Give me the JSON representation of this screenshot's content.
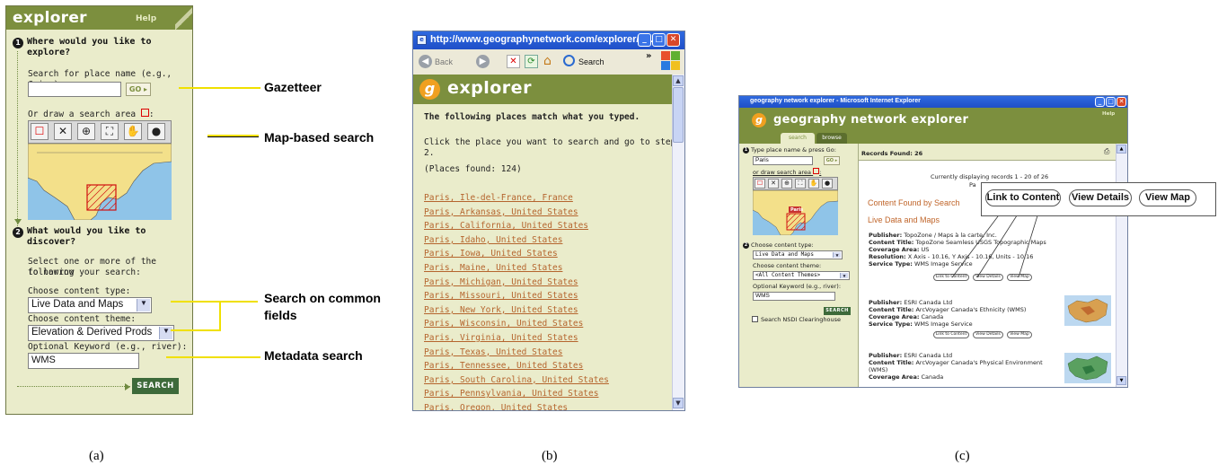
{
  "panel_a": {
    "logo": "explorer",
    "help": "Help",
    "step1_num": "1",
    "step1_title_line1": "Where would you like to",
    "step1_title_line2": "explore?",
    "search_place_label": "Search for place name (e.g., Cairo):",
    "go_label": "GO ▸",
    "draw_area_label": "Or draw a search area",
    "tools": [
      "☐",
      "✕",
      "⊕",
      "⛶",
      "✋",
      "🌐"
    ],
    "step2_num": "2",
    "step2_title_line1": "What would you like to",
    "step2_title_line2": "discover?",
    "select_hint_line1": "Select one or more of the following",
    "select_hint_line2": "to narrow your search:",
    "content_type_label": "Choose content type:",
    "content_type_value": "Live Data and Maps",
    "content_theme_label": "Choose content theme:",
    "content_theme_value": "Elevation & Derived Prods",
    "keyword_label": "Optional Keyword (e.g., river):",
    "keyword_value": "WMS",
    "search_button": "SEARCH"
  },
  "annotations": {
    "gazetteer": "Gazetteer",
    "map_search": "Map-based search",
    "common_fields_line1": "Search on common",
    "common_fields_line2": "fields",
    "metadata": "Metadata search"
  },
  "panel_b": {
    "url": "http://www.geographynetwork.com/explorer/g...",
    "back": "Back",
    "search": "Search",
    "logo": "explorer",
    "heading": "The following places match what you typed.",
    "instruction": "Click the place you want to search and go to step 2.",
    "found": "(Places found: 124)",
    "places": [
      "Paris, Ile-del-France, France",
      "Paris, Arkansas, United States",
      "Paris, California, United States",
      "Paris, Idaho, United States",
      "Paris, Iowa, United States",
      "Paris, Maine, United States",
      "Paris, Michigan, United States",
      "Paris, Missouri, United States",
      "Paris, New York, United States",
      "Paris, Wisconsin, United States",
      "Paris, Virginia, United States",
      "Paris, Texas, United States",
      "Paris, Tennessee, United States",
      "Paris, South Carolina, United States",
      "Paris, Pennsylvania, United States",
      "Paris, Oregon, United States"
    ]
  },
  "panel_c": {
    "window_title": "geography network explorer - Microsoft Internet Explorer",
    "logo": "geography network explorer",
    "help": "Help",
    "tabs": [
      "search",
      "browse"
    ],
    "type_label": "Type place name & press Go:",
    "place_value": "Paris",
    "go_label": "GO ▸",
    "draw_label": "or draw search area",
    "map_label": "Paris",
    "content_type_label": "Choose content type:",
    "content_type_value": "Live Data and Maps",
    "content_theme_label": "Choose content theme:",
    "content_theme_value": "<All Content Themes>",
    "keyword_label": "Optional Keyword (e.g., river):",
    "keyword_value": "WMS",
    "search_button": "SEARCH",
    "nsdi_label": "Search NSDI Clearinghouse",
    "records_found": "Records Found: 26",
    "displaying": "Currently displaying records 1 - 20 of 26",
    "page_label": "Pa",
    "content_found": "Content Found by Search",
    "live_data": "Live Data and Maps",
    "records": [
      {
        "publisher_label": "Publisher:",
        "publisher": "TopoZone / Maps à la carte, Inc.",
        "title_label": "Content Title:",
        "title": "TopoZone Seamless USGS Topographic Maps",
        "area_label": "Coverage Area:",
        "area": "US",
        "res_label": "Resolution:",
        "res": "X Axis - 10.16, Y Axis - 10.16, Units - 10.16",
        "service_label": "Service Type:",
        "service": "WMS Image Service"
      },
      {
        "publisher_label": "Publisher:",
        "publisher": "ESRI Canada Ltd",
        "title_label": "Content Title:",
        "title": "ArcVoyager Canada's Ethnicity (WMS)",
        "area_label": "Coverage Area:",
        "area": "Canada",
        "service_label": "Service Type:",
        "service": "WMS Image Service"
      },
      {
        "publisher_label": "Publisher:",
        "publisher": "ESRI Canada Ltd",
        "title_label": "Content Title:",
        "title": "ArcVoyager Canada's Physical Environment",
        "title2": "(WMS)",
        "area_label": "Coverage Area:",
        "area": "Canada"
      }
    ],
    "btn_link": "Link to Content",
    "btn_details": "View Details",
    "btn_map": "View Map"
  },
  "callout": {
    "link": "Link to Content",
    "details": "View Details",
    "map": "View Map"
  },
  "captions": [
    "(a)",
    "(b)",
    "(c)"
  ],
  "colors": {
    "olive": "#7c8f3e",
    "panel_bg": "#eaeccb",
    "link": "#b5652e",
    "accent_yellow": "#f0e000"
  }
}
